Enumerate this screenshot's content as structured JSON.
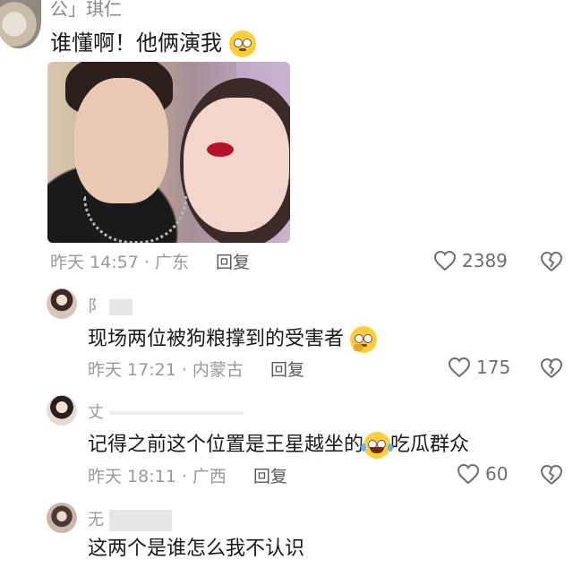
{
  "main_comment": {
    "author": "公」琪仁",
    "text": "谁懂啊！他俩演我",
    "emoji": "rolling-eyes-emoji",
    "time_location": "昨天 14:57 · 广东",
    "reply_label": "回复",
    "likes": "2389"
  },
  "replies": [
    {
      "author": "阝",
      "text": "现场两位被狗粮撑到的受害者",
      "emoji": "thinking-emoji",
      "time_location": "昨天 17:21 · 内蒙古",
      "reply_label": "回复",
      "likes": "175"
    },
    {
      "author": "丈",
      "text_before": "记得之前这个位置是王星越坐的",
      "emoji": "laughing-tears-emoji",
      "text_after": "吃瓜群众",
      "time_location": "昨天 18:11 · 广西",
      "reply_label": "回复",
      "likes": "60"
    },
    {
      "author": "无",
      "text": "这两个是谁怎么我不认识"
    }
  ],
  "colors": {
    "text": "#1a1a1a",
    "meta": "#9a9a9a",
    "reply": "#5a5a5a",
    "icon": "#6e6e6e"
  }
}
